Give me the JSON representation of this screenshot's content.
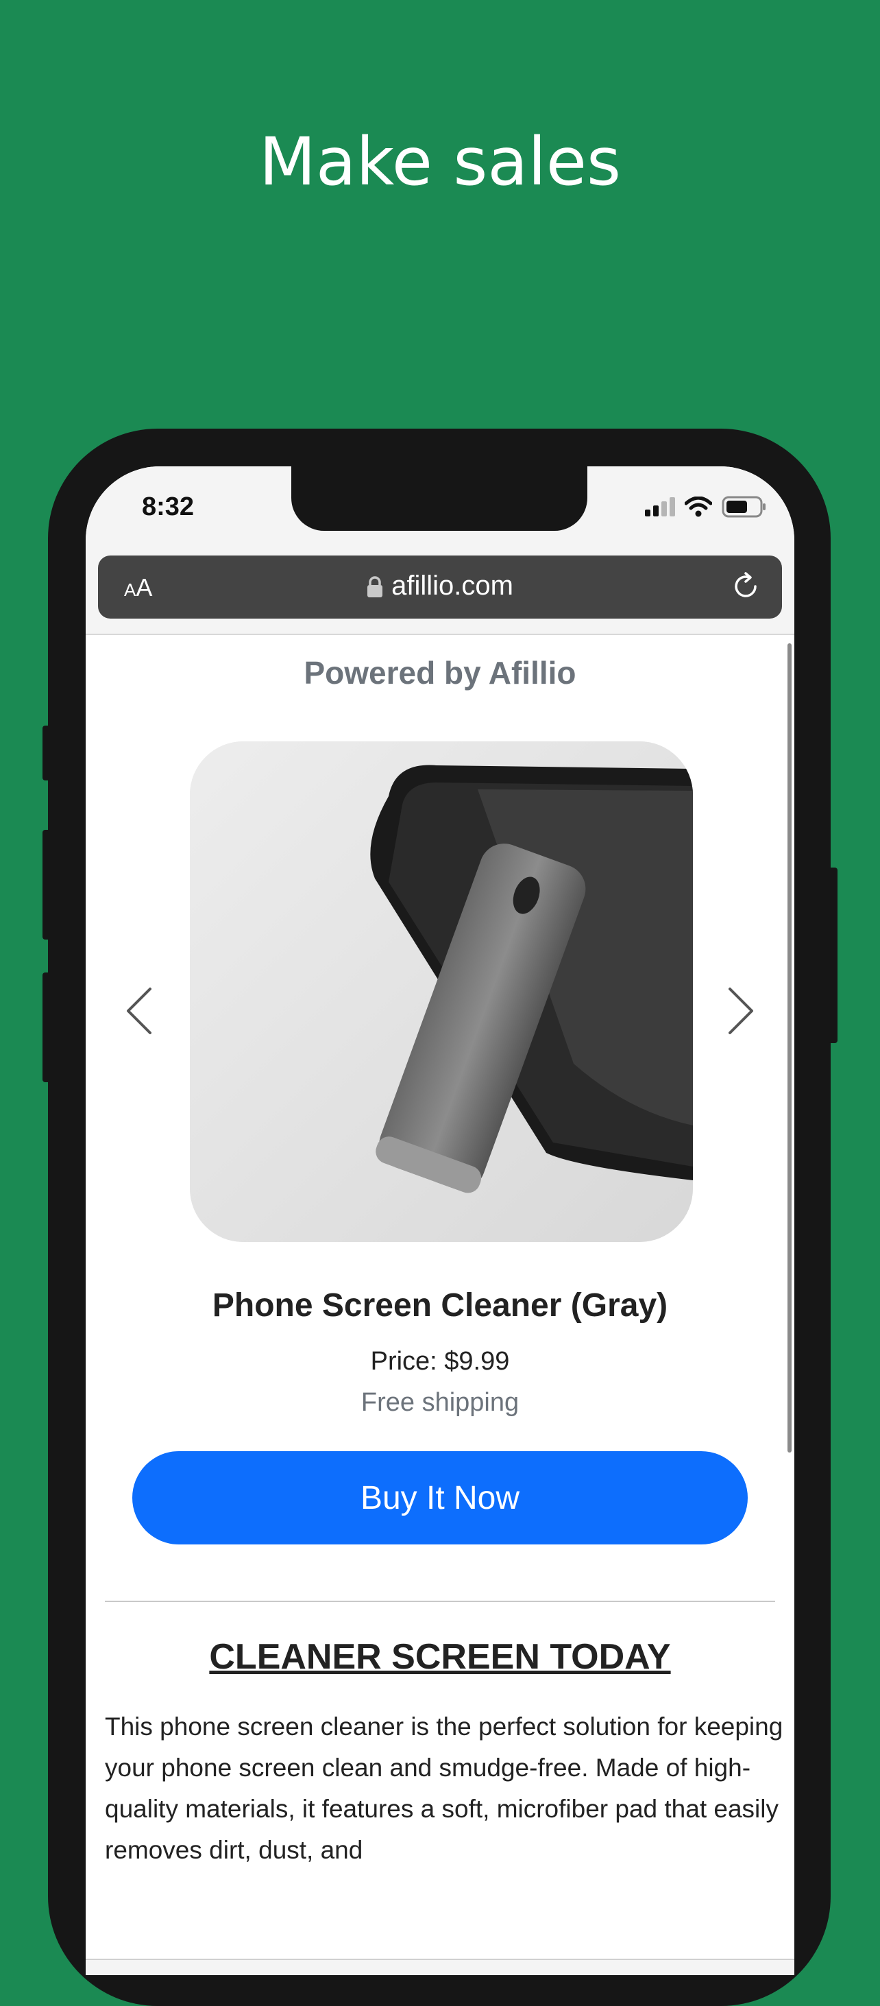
{
  "header": {
    "headline": "Make sales"
  },
  "status_bar": {
    "time": "8:32"
  },
  "browser": {
    "text_size_label_small": "A",
    "text_size_label_large": "A",
    "url": "afillio.com"
  },
  "page": {
    "powered_by": "Powered by Afillio",
    "product": {
      "title": "Phone Screen Cleaner (Gray)",
      "price": "Price: $9.99",
      "shipping": "Free shipping",
      "buy_label": "Buy It Now"
    },
    "section_title": "CLEANER SCREEN TODAY",
    "description": "This phone screen cleaner is the perfect solution for keeping your phone screen clean and smudge-free. Made of high-quality materials, it features a soft, microfiber pad that easily removes dirt, dust, and"
  },
  "colors": {
    "background": "#1b8a53",
    "buy_button": "#0d6efd",
    "muted_text": "#6c737b"
  },
  "icons": [
    "lock-icon",
    "reload-icon",
    "chevron-left-icon",
    "chevron-right-icon",
    "signal-icon",
    "wifi-icon",
    "battery-icon",
    "back-icon",
    "forward-icon",
    "share-icon",
    "bookmarks-icon",
    "tabs-icon"
  ]
}
